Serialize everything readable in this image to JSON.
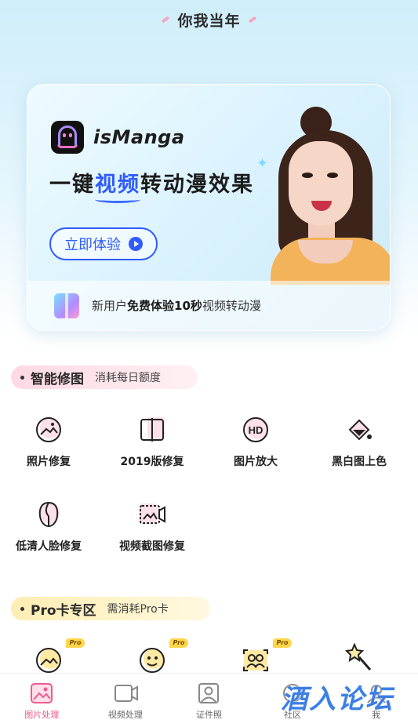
{
  "header": {
    "title": "你我当年"
  },
  "banner": {
    "brand": "isManga",
    "headline_before": "一键",
    "headline_highlight": "视频",
    "headline_after": "转动漫效果",
    "cta_label": "立即体验",
    "footer_prefix": "新用户",
    "footer_bold": "免费体验10秒",
    "footer_suffix": "视频转动漫"
  },
  "section_smart": {
    "name": "智能修图",
    "sub": "消耗每日额度",
    "tools": [
      {
        "label": "照片修复",
        "icon": "photo-restore-icon"
      },
      {
        "label": "2019版修复",
        "icon": "split-frame-icon"
      },
      {
        "label": "图片放大",
        "icon": "hd-icon"
      },
      {
        "label": "黑白图上色",
        "icon": "paint-bucket-icon"
      },
      {
        "label": "低清人脸修复",
        "icon": "face-icon"
      },
      {
        "label": "视频截图修复",
        "icon": "video-frame-icon"
      }
    ]
  },
  "section_pro": {
    "name": "Pro卡专区",
    "sub": "需消耗Pro卡",
    "badge": "Pro"
  },
  "bottom_nav": {
    "items": [
      {
        "label": "图片处理",
        "icon": "image-icon"
      },
      {
        "label": "视频处理",
        "icon": "video-icon"
      },
      {
        "label": "证件照",
        "icon": "id-photo-icon"
      },
      {
        "label": "社区",
        "icon": "community-icon"
      },
      {
        "label": "我",
        "icon": "profile-icon"
      }
    ]
  },
  "watermark": "酒入论坛",
  "colors": {
    "accent_blue": "#2f5bff",
    "active_pink": "#ef5a91",
    "pro_yellow": "#ffd64a"
  }
}
